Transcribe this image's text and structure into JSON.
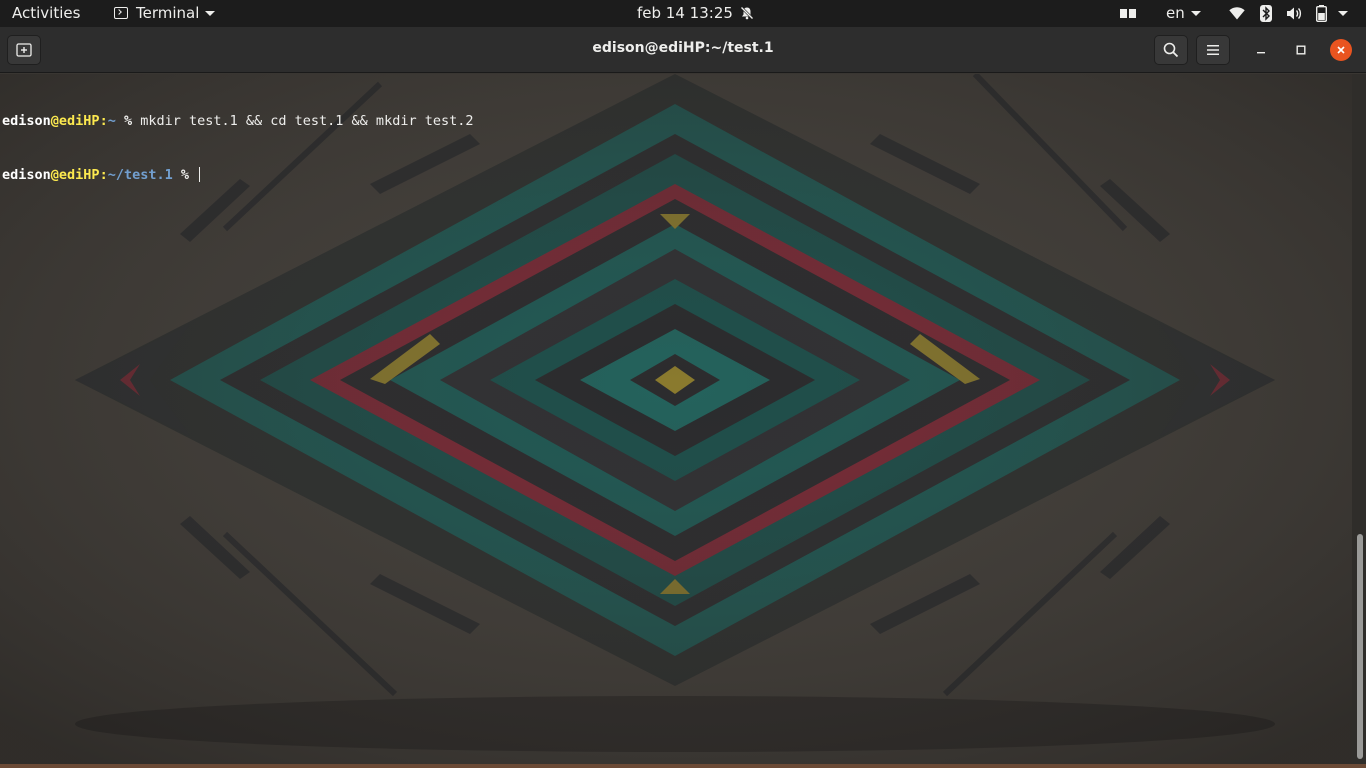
{
  "topbar": {
    "activities": "Activities",
    "app_name": "Terminal",
    "date": "feb 14",
    "time": "13:25",
    "lang": "en",
    "icons": [
      "bell-muted-icon",
      "keyboard-layout-icon",
      "wifi-icon",
      "bluetooth-icon",
      "volume-icon",
      "battery-icon",
      "chevron-down-icon"
    ]
  },
  "window": {
    "title": "edison@ediHP:~/test.1",
    "buttons": [
      "new-tab-icon",
      "search-icon",
      "hamburger-menu-icon",
      "minimize-icon",
      "maximize-icon",
      "close-icon"
    ]
  },
  "terminal": {
    "line1": {
      "user": "edison",
      "at": "@",
      "host": "ediHP",
      "sep": ":",
      "path": "~",
      "prompt": " % ",
      "command": "mkdir test.1 && cd test.1 && mkdir test.2"
    },
    "line2": {
      "user": "edison",
      "at": "@",
      "host": "ediHP",
      "sep": ":",
      "path": "~/test.1",
      "prompt": " % "
    }
  },
  "colors": {
    "topbar_bg": "#1c1c1c",
    "headerbar_bg": "#2d2d2d",
    "close_button": "#e95420",
    "host_color": "#fce94f",
    "path_color": "#729fcf",
    "art_teal": "#1f5a55",
    "art_red": "#7a2a36",
    "art_gold": "#8a7a2e"
  }
}
